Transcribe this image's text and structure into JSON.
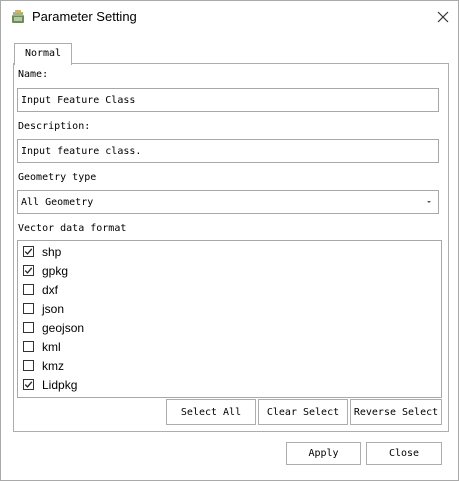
{
  "window": {
    "title": "Parameter Setting",
    "close_icon": "close-icon",
    "app_icon": "app-icon"
  },
  "tabs": [
    {
      "label": "Normal"
    }
  ],
  "form": {
    "name_label": "Name:",
    "name_value": "Input Feature Class",
    "description_label": "Description:",
    "description_value": "Input feature class.",
    "geometry_label": "Geometry type",
    "geometry_value": "All Geometry",
    "vector_label": "Vector data format"
  },
  "formats": [
    {
      "label": "shp",
      "checked": true
    },
    {
      "label": "gpkg",
      "checked": true
    },
    {
      "label": "dxf",
      "checked": false
    },
    {
      "label": "json",
      "checked": false
    },
    {
      "label": "geojson",
      "checked": false
    },
    {
      "label": "kml",
      "checked": false
    },
    {
      "label": "kmz",
      "checked": false
    },
    {
      "label": "Lidpkg",
      "checked": true
    }
  ],
  "list_buttons": {
    "select_all": "Select All",
    "clear_select": "Clear Select",
    "reverse_select": "Reverse Select"
  },
  "footer": {
    "apply": "Apply",
    "close": "Close"
  }
}
